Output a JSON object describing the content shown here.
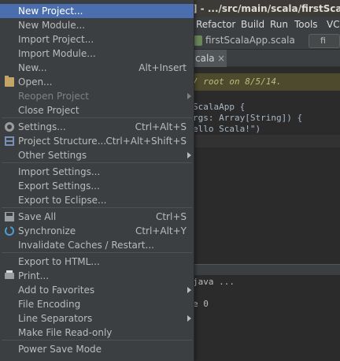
{
  "window": {
    "title": "] - .../src/main/scala/firstScalaApp"
  },
  "menubar": {
    "items": [
      {
        "label": "Refactor"
      },
      {
        "label": "Build"
      },
      {
        "label": "Run"
      },
      {
        "label": "Tools"
      },
      {
        "label": "VC"
      }
    ]
  },
  "breadcrumb": {
    "file": "firstScalaApp.scala",
    "right_field": "fi"
  },
  "editor_tab": {
    "label": "cala",
    "close": "×"
  },
  "editor": {
    "lines": [
      "/ root on 8/5/14.",
      "ScalaApp {",
      "rgs: Array[String]) {",
      "ello Scala!\")"
    ]
  },
  "console": {
    "lines": [
      "java ...",
      "e 0"
    ]
  },
  "file_menu": {
    "items": [
      {
        "label": "New Project...",
        "shortcut": "",
        "icon": "",
        "submenu": false,
        "disabled": false,
        "highlighted": true
      },
      {
        "label": "New Module...",
        "shortcut": "",
        "icon": "",
        "submenu": false,
        "disabled": false
      },
      {
        "label": "Import Project...",
        "shortcut": "",
        "icon": "",
        "submenu": false,
        "disabled": false
      },
      {
        "label": "Import Module...",
        "shortcut": "",
        "icon": "",
        "submenu": false,
        "disabled": false
      },
      {
        "label": "New...",
        "shortcut": "Alt+Insert",
        "icon": "",
        "submenu": false,
        "disabled": false
      },
      {
        "label": "Open...",
        "shortcut": "",
        "icon": "folder-icon",
        "submenu": false,
        "disabled": false
      },
      {
        "label": "Reopen Project",
        "shortcut": "",
        "icon": "",
        "submenu": true,
        "disabled": true
      },
      {
        "label": "Close Project",
        "shortcut": "",
        "icon": "",
        "submenu": false,
        "disabled": false
      },
      {
        "label": "Settings...",
        "shortcut": "Ctrl+Alt+S",
        "icon": "gear-icon",
        "submenu": false,
        "disabled": false
      },
      {
        "label": "Project Structure...",
        "shortcut": "Ctrl+Alt+Shift+S",
        "icon": "project-structure-icon",
        "submenu": false,
        "disabled": false
      },
      {
        "label": "Other Settings",
        "shortcut": "",
        "icon": "",
        "submenu": true,
        "disabled": false
      },
      {
        "label": "Import Settings...",
        "shortcut": "",
        "icon": "",
        "submenu": false,
        "disabled": false
      },
      {
        "label": "Export Settings...",
        "shortcut": "",
        "icon": "",
        "submenu": false,
        "disabled": false
      },
      {
        "label": "Export to Eclipse...",
        "shortcut": "",
        "icon": "",
        "submenu": false,
        "disabled": false
      },
      {
        "label": "Save All",
        "shortcut": "Ctrl+S",
        "icon": "save-icon",
        "submenu": false,
        "disabled": false
      },
      {
        "label": "Synchronize",
        "shortcut": "Ctrl+Alt+Y",
        "icon": "synchronize-icon",
        "submenu": false,
        "disabled": false
      },
      {
        "label": "Invalidate Caches / Restart...",
        "shortcut": "",
        "icon": "",
        "submenu": false,
        "disabled": false
      },
      {
        "label": "Export to HTML...",
        "shortcut": "",
        "icon": "",
        "submenu": false,
        "disabled": false
      },
      {
        "label": "Print...",
        "shortcut": "",
        "icon": "print-icon",
        "submenu": false,
        "disabled": false
      },
      {
        "label": "Add to Favorites",
        "shortcut": "",
        "icon": "",
        "submenu": true,
        "disabled": false
      },
      {
        "label": "File Encoding",
        "shortcut": "",
        "icon": "",
        "submenu": false,
        "disabled": false
      },
      {
        "label": "Line Separators",
        "shortcut": "",
        "icon": "",
        "submenu": true,
        "disabled": false
      },
      {
        "label": "Make File Read-only",
        "shortcut": "",
        "icon": "",
        "submenu": false,
        "disabled": false
      },
      {
        "label": "Power Save Mode",
        "shortcut": "",
        "icon": "",
        "submenu": false,
        "disabled": false
      }
    ]
  }
}
